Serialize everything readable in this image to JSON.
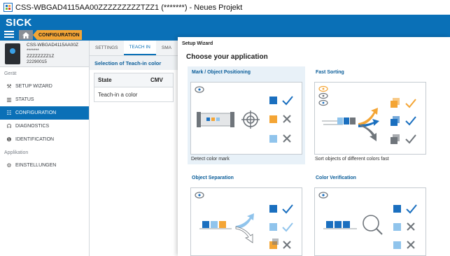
{
  "window": {
    "title": "CSS-WBGAD4115AA00ZZZZZZZZZTZZ1 (*******) - Neues Projekt"
  },
  "header": {
    "logo": "SICK",
    "breadcrumb": "CONFIGURATION"
  },
  "device": {
    "name": "CSS-WBGAD4115AA00Z",
    "masked": "*******",
    "variant": "ZZZZZZZZ1Z",
    "serial": "22290015"
  },
  "sidebar": {
    "section_device": "Gerät",
    "items": [
      {
        "label": "SETUP WIZARD",
        "icon": "wand-icon",
        "glyph": "⚒"
      },
      {
        "label": "STATUS",
        "icon": "chart-icon",
        "glyph": "▥"
      },
      {
        "label": "CONFIGURATION",
        "icon": "grid-icon",
        "glyph": "☷"
      },
      {
        "label": "DIAGNOSTICS",
        "icon": "stethoscope-icon",
        "glyph": "☊"
      },
      {
        "label": "IDENTIFICATION",
        "icon": "info-icon",
        "glyph": "❶"
      }
    ],
    "section_app": "Applikation",
    "app_items": [
      {
        "label": "EINSTELLUNGEN",
        "icon": "gears-icon",
        "glyph": "⚙"
      }
    ]
  },
  "midpanel": {
    "tabs": [
      "SETTINGS",
      "TEACH IN",
      "SMA"
    ],
    "heading": "Selection of Teach-in color",
    "table": {
      "columns": [
        "State",
        "CMV"
      ],
      "rows": [
        [
          "Teach-in a color",
          ""
        ]
      ]
    }
  },
  "wizard": {
    "title": "Setup Wizard",
    "subtitle": "Choose your application",
    "cards": [
      {
        "title": "Mark / Object Positioning",
        "desc": "Detect color mark"
      },
      {
        "title": "Fast Sorting",
        "desc": "Sort objects of different colors fast"
      },
      {
        "title": "Object Separation",
        "desc": ""
      },
      {
        "title": "Color Verification",
        "desc": ""
      }
    ]
  },
  "colors": {
    "brand_blue": "#0a70b7",
    "orange": "#f4a535",
    "check_blue": "#1a6fbf",
    "light_blue": "#90c4ec",
    "gray": "#6f757b"
  }
}
